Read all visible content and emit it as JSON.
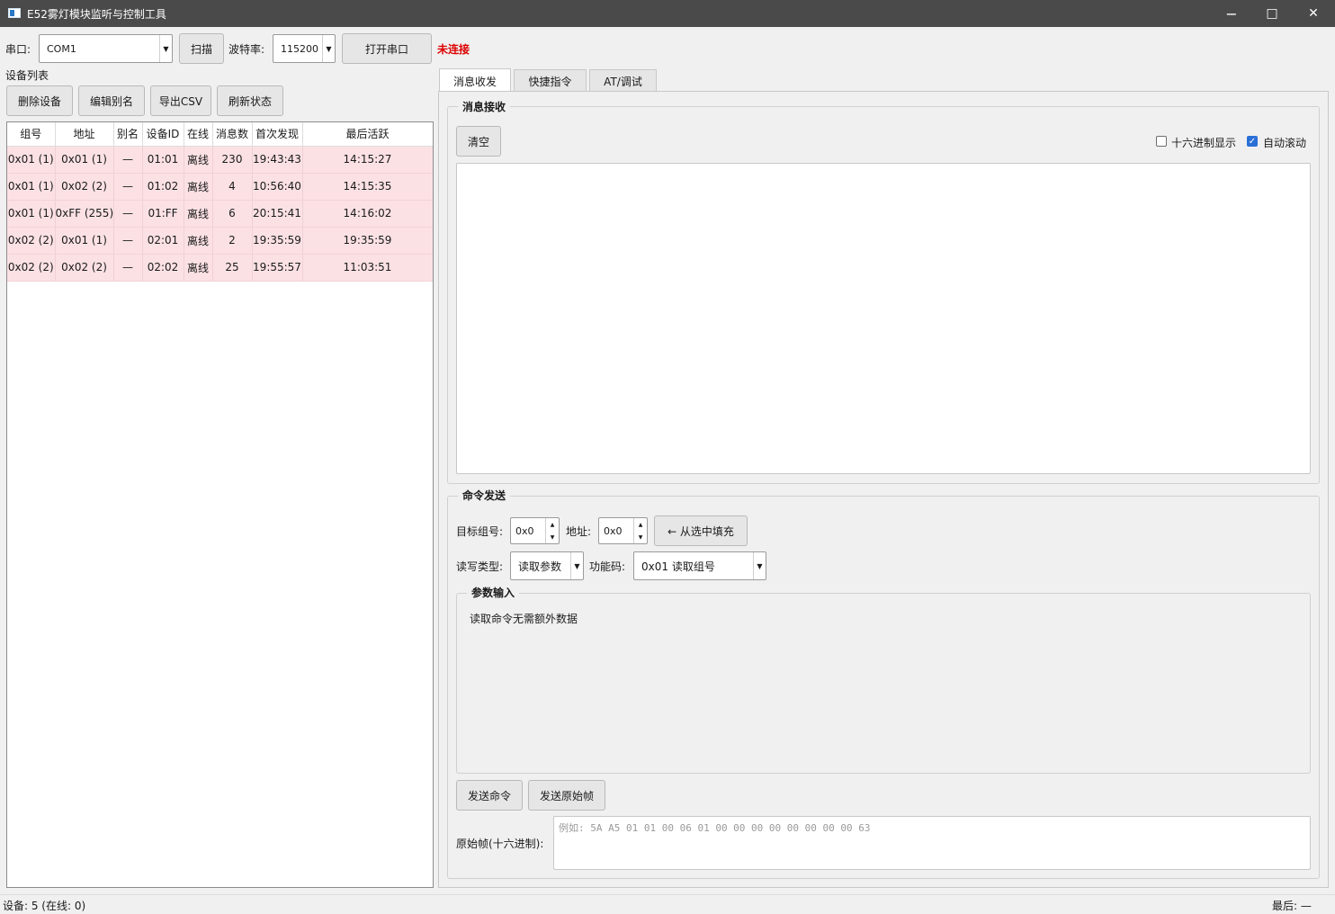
{
  "window": {
    "title": "E52雾灯模块监听与控制工具",
    "min": "−",
    "max": "□",
    "close": "✕"
  },
  "toolbar": {
    "port_label": "串口:",
    "port_value": "COM1",
    "scan_label": "扫描",
    "baud_label": "波特率:",
    "baud_value": "115200",
    "open_label": "打开串口",
    "status_text": "未连接",
    "status_color": "#dd0000"
  },
  "device_panel": {
    "title": "设备列表",
    "buttons": [
      "删除设备",
      "编辑别名",
      "导出CSV",
      "刷新状态"
    ],
    "columns": [
      "组号",
      "地址",
      "别名",
      "设备ID",
      "在线",
      "消息数",
      "首次发现",
      "最后活跃"
    ],
    "rows": [
      [
        "0x01 (1)",
        "0x01 (1)",
        "—",
        "01:01",
        "离线",
        "230",
        "19:43:43",
        "14:15:27"
      ],
      [
        "0x01 (1)",
        "0x02 (2)",
        "—",
        "01:02",
        "离线",
        "4",
        "10:56:40",
        "14:15:35"
      ],
      [
        "0x01 (1)",
        "0xFF (255)",
        "—",
        "01:FF",
        "离线",
        "6",
        "20:15:41",
        "14:16:02"
      ],
      [
        "0x02 (2)",
        "0x01 (1)",
        "—",
        "02:01",
        "离线",
        "2",
        "19:35:59",
        "19:35:59"
      ],
      [
        "0x02 (2)",
        "0x02 (2)",
        "—",
        "02:02",
        "离线",
        "25",
        "19:55:57",
        "11:03:51"
      ]
    ],
    "row_color": "#fbe1e4"
  },
  "tabs": [
    "消息收发",
    "快捷指令",
    "AT/调试"
  ],
  "receive": {
    "title": "消息接收",
    "clear_label": "清空",
    "hex_label": "十六进制显示",
    "hex_checked": false,
    "autoscroll_label": "自动滚动",
    "autoscroll_checked": true
  },
  "send": {
    "title": "命令发送",
    "group_label": "目标组号:",
    "group_value": "0x0",
    "addr_label": "地址:",
    "addr_value": "0x0",
    "fill_label": "← 从选中填充",
    "rw_label": "读写类型:",
    "rw_value": "读取参数",
    "func_label": "功能码:",
    "func_value": "0x01 读取组号",
    "param_title": "参数输入",
    "param_hint": "读取命令无需额外数据",
    "send_cmd_label": "发送命令",
    "send_raw_label": "发送原始帧",
    "raw_label": "原始帧(十六进制):",
    "raw_placeholder": "例如: 5A A5 01 01 00 06 01 00 00 00 00 00 00 00 00 63"
  },
  "statusbar": {
    "left": "设备: 5 (在线: 0)",
    "right": "最后: —"
  }
}
